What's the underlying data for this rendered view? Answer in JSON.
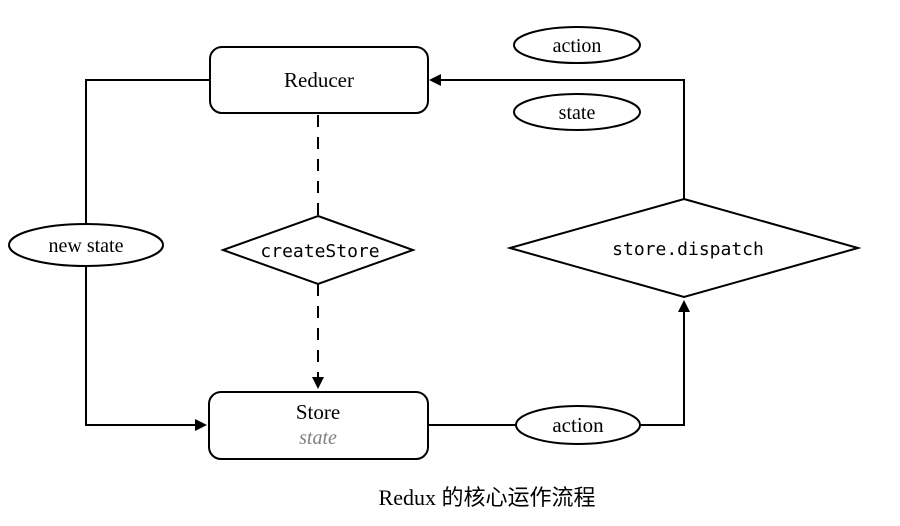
{
  "nodes": {
    "reducer": {
      "label": "Reducer"
    },
    "store": {
      "label": "Store",
      "sublabel": "state"
    },
    "create_store": {
      "label": "createStore"
    },
    "dispatch": {
      "label": "store.dispatch"
    }
  },
  "edge_labels": {
    "action_top": "action",
    "state_top": "state",
    "new_state": "new state",
    "action_bottom": "action"
  },
  "caption": "Redux 的核心运作流程",
  "colors": {
    "stroke": "#000000",
    "store_sublabel": "#808080",
    "background": "#ffffff"
  }
}
